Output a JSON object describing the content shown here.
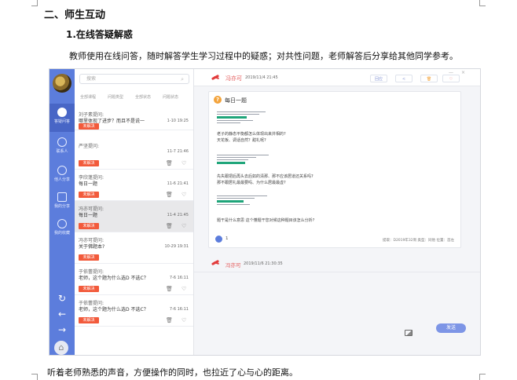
{
  "document": {
    "heading": "二、师生互动",
    "subheading": "1.在线答疑解惑",
    "paragraph": "教师使用在线问答，随时解答学生学习过程中的疑惑；对共性问题，老师解答后分享给其他同学参考。",
    "footer": "听着老师熟悉的声音，方便操作的同时，也拉近了心与心的距离。"
  },
  "nav": {
    "items": [
      {
        "label": "答疑问答",
        "icon": "chat-icon"
      },
      {
        "label": "联系人",
        "icon": "contacts-icon"
      },
      {
        "label": "他人分享",
        "icon": "share-icon"
      },
      {
        "label": "我的分享",
        "icon": "my-share-icon"
      },
      {
        "label": "我的收藏",
        "icon": "heart-icon"
      }
    ],
    "refresh_icon": "↻",
    "back_icon": "←",
    "forward_icon": "→",
    "home_icon": "⌂"
  },
  "list": {
    "search_placeholder": "搜索",
    "search_icon": "⌕",
    "filters": [
      "全部课程",
      "问题类型",
      "全部状态",
      "问题状态"
    ],
    "tag_label": "未解决",
    "delete_icon": "🗑",
    "fav_icon": "♡",
    "items": [
      {
        "asker": "刘子素提问:",
        "text": "哪里体现了进步？而且不是说一",
        "time": "1-10 19:25"
      },
      {
        "asker": "严坚提问:",
        "text": "",
        "time": "11-7 21:46"
      },
      {
        "asker": "李欣蓬提问:",
        "text": "每日一题",
        "time": "11-6 21:41"
      },
      {
        "asker": "冯亦可提问:",
        "text": "每日一题",
        "time": "11-4 21:45"
      },
      {
        "asker": "冯亦可提问:",
        "text": "关于佛题本?",
        "time": "10-29 19:31"
      },
      {
        "asker": "于依蕾提问:",
        "text": "老师，这个题为什么选D 不选C？",
        "time": "7-6 16:11"
      },
      {
        "asker": "于依蕾提问:",
        "text": "老师，这个题为什么选D 不选C？",
        "time": "7-6 16:11"
      }
    ]
  },
  "detail": {
    "author": "冯亦可",
    "date": "2019/11/4 21:45",
    "btn_reply": "回应",
    "btn_share": "<",
    "btn_delete": "🗑",
    "btn_fav": "♡",
    "window_min": "—",
    "window_close": "×",
    "card": {
      "badge": "?",
      "title": "每日一题",
      "lines": [
        "老子的静态平衡都怎么体现出来并相的?",
        "天花板、调话自然？甜礼呢?",
        "先失跟把后再头去后如的清那、那不应该居道还关系吗?",
        "那不跟居礼最最要吗、为什么居最最虚?",
        "题干是什么意思 这个懂题干您对候这种题目该怎么分析?"
      ],
      "index": "1",
      "meta": "提取：D2019年32周  类型：同他  位置：首左"
    },
    "reply_author": "冯亦可",
    "reply_date": "2019/11/6 21:30:35",
    "send": "发送",
    "image_icon": "image-icon"
  }
}
